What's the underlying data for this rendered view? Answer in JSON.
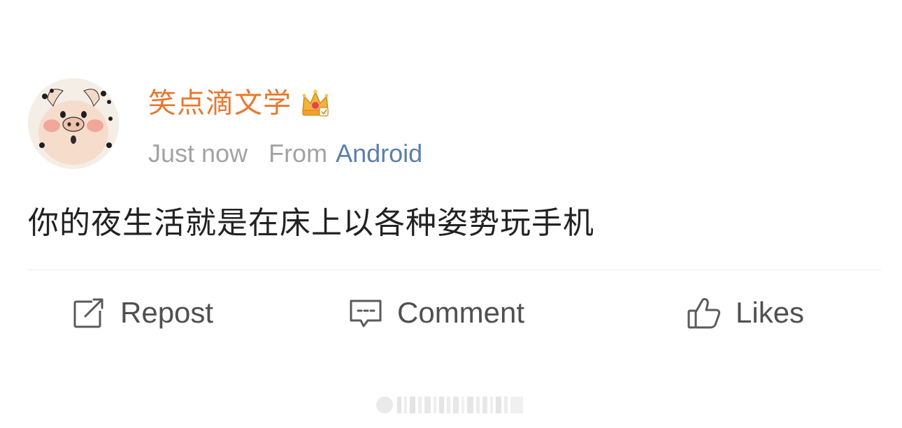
{
  "post": {
    "author": {
      "name": "笑点滴文学",
      "avatar_icon": "pig-face-avatar",
      "badge_icon": "crown-icon"
    },
    "meta": {
      "time": "Just now",
      "from_label": "From",
      "source": "Android"
    },
    "content": "你的夜生活就是在床上以各种姿势玩手机"
  },
  "actions": {
    "repost_label": "Repost",
    "comment_label": "Comment",
    "likes_label": "Likes"
  },
  "colors": {
    "author_name": "#e8772e",
    "source_link": "#5b7fa8",
    "meta_text": "#a3a3a3",
    "content_text": "#222222",
    "action_text": "#505050"
  }
}
